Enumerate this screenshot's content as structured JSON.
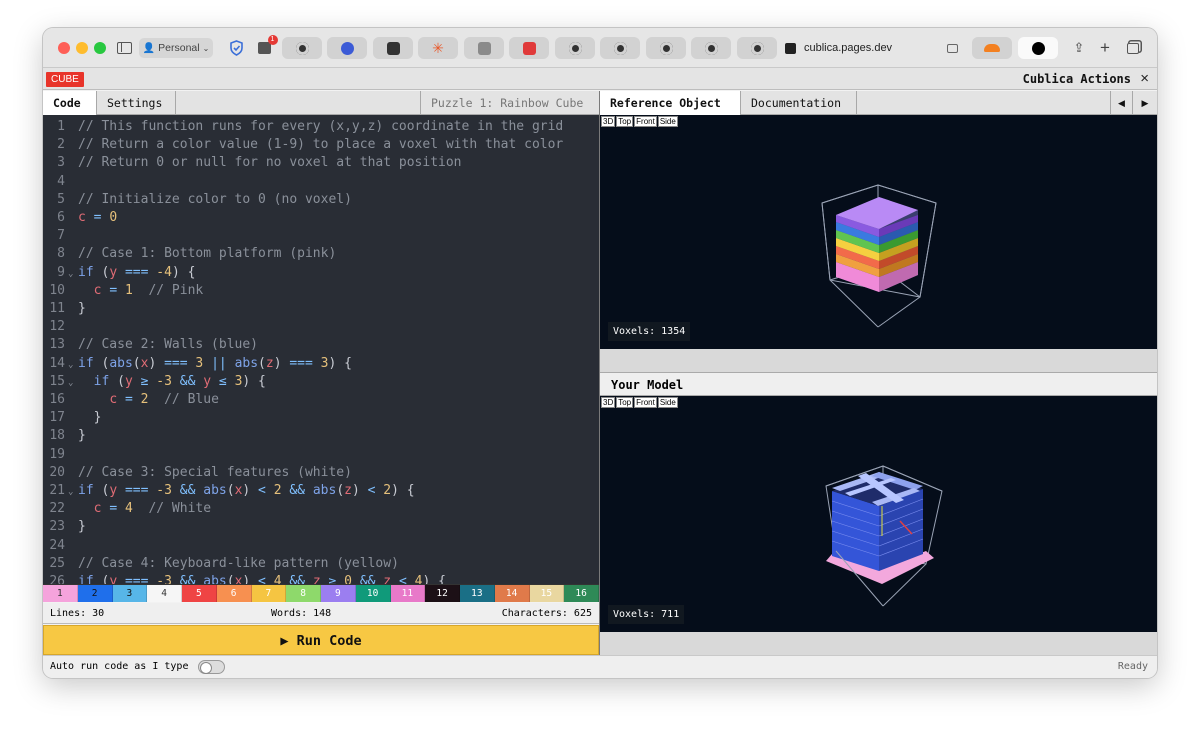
{
  "browser": {
    "profile_label": "Personal",
    "url": "cublica.pages.dev",
    "badge_count": "1"
  },
  "app": {
    "badge": "CUBE",
    "actions_title": "Cublica Actions",
    "close_symbol": "×"
  },
  "left_tabs": {
    "code": "Code",
    "settings": "Settings",
    "puzzle": "Puzzle 1: Rainbow Cube"
  },
  "right_tabs": {
    "reference": "Reference Object",
    "documentation": "Documentation",
    "prev": "◀",
    "next": "▶"
  },
  "code_lines": [
    {
      "n": "1",
      "html": "<span class='cm'>// This function runs for every (x,y,z) coordinate in the grid</span>"
    },
    {
      "n": "2",
      "html": "<span class='cm'>// Return a color value (1-9) to place a voxel with that color</span>"
    },
    {
      "n": "3",
      "html": "<span class='cm'>// Return 0 or null for no voxel at that position</span>"
    },
    {
      "n": "4",
      "html": ""
    },
    {
      "n": "5",
      "html": "<span class='cm'>// Initialize color to 0 (no voxel)</span>"
    },
    {
      "n": "6",
      "html": "<span class='vr'>c</span> <span class='op'>=</span> <span class='nm'>0</span>"
    },
    {
      "n": "7",
      "html": ""
    },
    {
      "n": "8",
      "html": "<span class='cm'>// Case 1: Bottom platform (pink)</span>"
    },
    {
      "n": "9",
      "fold": true,
      "html": "<span class='kw'>if</span> (<span class='vr'>y</span> <span class='op'>===</span> <span class='nm'>-4</span>) {"
    },
    {
      "n": "10",
      "html": "  <span class='vr'>c</span> <span class='op'>=</span> <span class='nm'>1</span>  <span class='cm'>// Pink</span>"
    },
    {
      "n": "11",
      "html": "}"
    },
    {
      "n": "12",
      "html": ""
    },
    {
      "n": "13",
      "html": "<span class='cm'>// Case 2: Walls (blue)</span>"
    },
    {
      "n": "14",
      "fold": true,
      "html": "<span class='kw'>if</span> (<span class='fn'>abs</span>(<span class='vr'>x</span>) <span class='op'>===</span> <span class='nm'>3</span> <span class='op'>||</span> <span class='fn'>abs</span>(<span class='vr'>z</span>) <span class='op'>===</span> <span class='nm'>3</span>) {"
    },
    {
      "n": "15",
      "fold": true,
      "html": "  <span class='kw'>if</span> (<span class='vr'>y</span> <span class='op'>≥</span> <span class='nm'>-3</span> <span class='op'>&amp;&amp;</span> <span class='vr'>y</span> <span class='op'>≤</span> <span class='nm'>3</span>) {"
    },
    {
      "n": "16",
      "html": "    <span class='vr'>c</span> <span class='op'>=</span> <span class='nm'>2</span>  <span class='cm'>// Blue</span>"
    },
    {
      "n": "17",
      "html": "  }"
    },
    {
      "n": "18",
      "html": "}"
    },
    {
      "n": "19",
      "html": ""
    },
    {
      "n": "20",
      "html": "<span class='cm'>// Case 3: Special features (white)</span>"
    },
    {
      "n": "21",
      "fold": true,
      "html": "<span class='kw'>if</span> (<span class='vr'>y</span> <span class='op'>===</span> <span class='nm'>-3</span> <span class='op'>&amp;&amp;</span> <span class='fn'>abs</span>(<span class='vr'>x</span>) <span class='op'>&lt;</span> <span class='nm'>2</span> <span class='op'>&amp;&amp;</span> <span class='fn'>abs</span>(<span class='vr'>z</span>) <span class='op'>&lt;</span> <span class='nm'>2</span>) {"
    },
    {
      "n": "22",
      "html": "  <span class='vr'>c</span> <span class='op'>=</span> <span class='nm'>4</span>  <span class='cm'>// White</span>"
    },
    {
      "n": "23",
      "html": "}"
    },
    {
      "n": "24",
      "html": ""
    },
    {
      "n": "25",
      "html": "<span class='cm'>// Case 4: Keyboard-like pattern (yellow)</span>"
    },
    {
      "n": "26",
      "html": "<span class='kw'>if</span> (<span class='vr'>y</span> <span class='op'>===</span> <span class='nm'>-3</span> <span class='op'>&amp;&amp;</span> <span class='fn'>abs</span>(<span class='vr'>x</span>) <span class='op'>&lt;</span> <span class='nm'>4</span> <span class='op'>&amp;&amp;</span> <span class='vr'>z</span> <span class='op'>≥</span> <span class='nm'>0</span> <span class='op'>&amp;&amp;</span> <span class='vr'>z</span> <span class='op'>&lt;</span> <span class='nm'>4</span>) {"
    }
  ],
  "palette": [
    {
      "label": "1",
      "color": "#f5a3dc",
      "text": "#333"
    },
    {
      "label": "2",
      "color": "#1f6feb",
      "text": "#111"
    },
    {
      "label": "3",
      "color": "#57b6e8",
      "text": "#111"
    },
    {
      "label": "4",
      "color": "#f6f6f6",
      "text": "#333"
    },
    {
      "label": "5",
      "color": "#ef4444",
      "text": "#fff"
    },
    {
      "label": "6",
      "color": "#f79050",
      "text": "#fff"
    },
    {
      "label": "7",
      "color": "#f5c542",
      "text": "#fff"
    },
    {
      "label": "8",
      "color": "#8ed96b",
      "text": "#fff"
    },
    {
      "label": "9",
      "color": "#9b7ef0",
      "text": "#fff"
    },
    {
      "label": "10",
      "color": "#109a7a",
      "text": "#fff"
    },
    {
      "label": "11",
      "color": "#e879c9",
      "text": "#fff"
    },
    {
      "label": "12",
      "color": "#1c1016",
      "text": "#fff"
    },
    {
      "label": "13",
      "color": "#1a6f86",
      "text": "#fff"
    },
    {
      "label": "14",
      "color": "#e07a4a",
      "text": "#fff"
    },
    {
      "label": "15",
      "color": "#e9d7a0",
      "text": "#fff"
    },
    {
      "label": "16",
      "color": "#2e8a57",
      "text": "#fff"
    }
  ],
  "stats": {
    "lines": "Lines: 30",
    "words": "Words: 148",
    "characters": "Characters: 625"
  },
  "run_label": "▶ Run Code",
  "footer": {
    "auto_run": "Auto run code as I type",
    "status": "Ready"
  },
  "view_buttons": [
    "3D",
    "Top",
    "Front",
    "Side"
  ],
  "reference": {
    "voxels": "Voxels: 1354"
  },
  "your_model": {
    "title": "Your Model",
    "voxels": "Voxels: 711"
  }
}
